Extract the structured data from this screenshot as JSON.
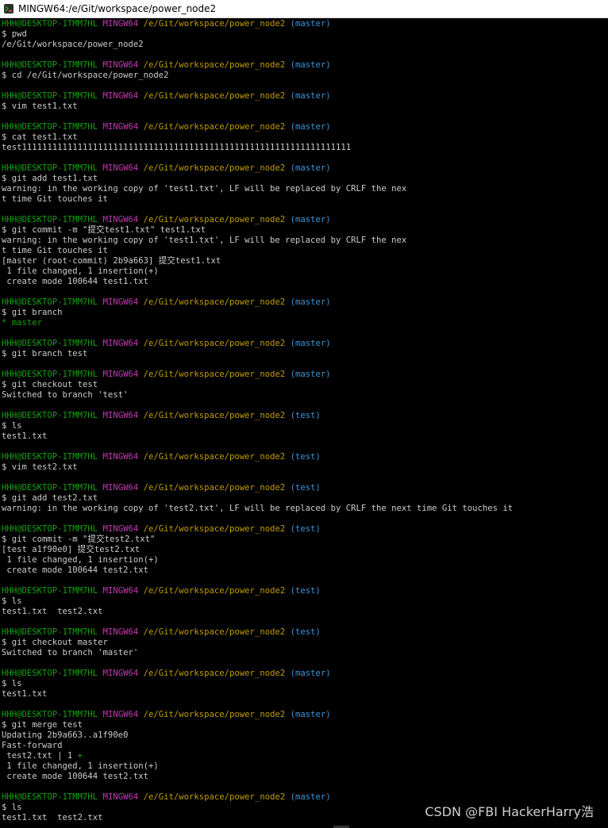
{
  "window": {
    "title": "MINGW64:/e/Git/workspace/power_node2"
  },
  "colors": {
    "background": "#000000",
    "text": "#cccccc",
    "user_host": "#13a10e",
    "mingw": "#c239b3",
    "path": "#c19c00",
    "branch": "#3a96dd"
  },
  "prompt": {
    "user_host": "HHH@DESKTOP-1TMM7HL",
    "env": "MINGW64",
    "path": "/e/Git/workspace/power_node2"
  },
  "lines": [
    {
      "type": "prompt",
      "branch": "(master)"
    },
    {
      "type": "text",
      "text": "$ pwd"
    },
    {
      "type": "text",
      "text": "/e/Git/workspace/power_node2"
    },
    {
      "type": "blank"
    },
    {
      "type": "prompt",
      "branch": "(master)"
    },
    {
      "type": "text",
      "text": "$ cd /e/Git/workspace/power_node2"
    },
    {
      "type": "blank"
    },
    {
      "type": "prompt",
      "branch": "(master)"
    },
    {
      "type": "text",
      "text": "$ vim test1.txt"
    },
    {
      "type": "blank"
    },
    {
      "type": "prompt",
      "branch": "(master)"
    },
    {
      "type": "text",
      "text": "$ cat test1.txt"
    },
    {
      "type": "text",
      "text": "test11111111111111111111111111111111111111111111111111111111111111111"
    },
    {
      "type": "blank"
    },
    {
      "type": "prompt",
      "branch": "(master)"
    },
    {
      "type": "text",
      "text": "$ git add test1.txt"
    },
    {
      "type": "text",
      "text": "warning: in the working copy of 'test1.txt', LF will be replaced by CRLF the nex"
    },
    {
      "type": "text",
      "text": "t time Git touches it"
    },
    {
      "type": "blank"
    },
    {
      "type": "prompt",
      "branch": "(master)"
    },
    {
      "type": "text",
      "text": "$ git commit -m \"提交test1.txt\" test1.txt"
    },
    {
      "type": "text",
      "text": "warning: in the working copy of 'test1.txt', LF will be replaced by CRLF the nex"
    },
    {
      "type": "text",
      "text": "t time Git touches it"
    },
    {
      "type": "text",
      "text": "[master (root-commit) 2b9a663] 提交test1.txt"
    },
    {
      "type": "text",
      "text": " 1 file changed, 1 insertion(+)"
    },
    {
      "type": "text",
      "text": " create mode 100644 test1.txt"
    },
    {
      "type": "blank"
    },
    {
      "type": "prompt",
      "branch": "(master)"
    },
    {
      "type": "text",
      "text": "$ git branch"
    },
    {
      "type": "current_branch",
      "text": "* master"
    },
    {
      "type": "blank"
    },
    {
      "type": "prompt",
      "branch": "(master)"
    },
    {
      "type": "text",
      "text": "$ git branch test"
    },
    {
      "type": "blank"
    },
    {
      "type": "prompt",
      "branch": "(master)"
    },
    {
      "type": "text",
      "text": "$ git checkout test"
    },
    {
      "type": "text",
      "text": "Switched to branch 'test'"
    },
    {
      "type": "blank"
    },
    {
      "type": "prompt",
      "branch": "(test)"
    },
    {
      "type": "text",
      "text": "$ ls"
    },
    {
      "type": "text",
      "text": "test1.txt"
    },
    {
      "type": "blank"
    },
    {
      "type": "prompt",
      "branch": "(test)"
    },
    {
      "type": "text",
      "text": "$ vim test2.txt"
    },
    {
      "type": "blank"
    },
    {
      "type": "prompt",
      "branch": "(test)"
    },
    {
      "type": "text",
      "text": "$ git add test2.txt"
    },
    {
      "type": "text",
      "text": "warning: in the working copy of 'test2.txt', LF will be replaced by CRLF the next time Git touches it"
    },
    {
      "type": "blank"
    },
    {
      "type": "prompt",
      "branch": "(test)"
    },
    {
      "type": "text",
      "text": "$ git commit -m \"提交test2.txt\""
    },
    {
      "type": "text",
      "text": "[test a1f90e0] 提交test2.txt"
    },
    {
      "type": "text",
      "text": " 1 file changed, 1 insertion(+)"
    },
    {
      "type": "text",
      "text": " create mode 100644 test2.txt"
    },
    {
      "type": "blank"
    },
    {
      "type": "prompt",
      "branch": "(test)"
    },
    {
      "type": "text",
      "text": "$ ls"
    },
    {
      "type": "text",
      "text": "test1.txt  test2.txt"
    },
    {
      "type": "blank"
    },
    {
      "type": "prompt",
      "branch": "(test)"
    },
    {
      "type": "text",
      "text": "$ git checkout master"
    },
    {
      "type": "text",
      "text": "Switched to branch 'master'"
    },
    {
      "type": "blank"
    },
    {
      "type": "prompt",
      "branch": "(master)"
    },
    {
      "type": "text",
      "text": "$ ls"
    },
    {
      "type": "text",
      "text": "test1.txt"
    },
    {
      "type": "blank"
    },
    {
      "type": "prompt",
      "branch": "(master)"
    },
    {
      "type": "text",
      "text": "$ git merge test"
    },
    {
      "type": "text",
      "text": "Updating 2b9a663..a1f90e0"
    },
    {
      "type": "text",
      "text": "Fast-forward"
    },
    {
      "type": "diffstat",
      "text": " test2.txt | 1 ",
      "plus": "+"
    },
    {
      "type": "text",
      "text": " 1 file changed, 1 insertion(+)"
    },
    {
      "type": "text",
      "text": " create mode 100644 test2.txt"
    },
    {
      "type": "blank"
    },
    {
      "type": "prompt",
      "branch": "(master)"
    },
    {
      "type": "text",
      "text": "$ ls"
    },
    {
      "type": "text",
      "text": "test1.txt  test2.txt"
    }
  ],
  "watermark": "CSDN @FBI HackerHarry浩"
}
